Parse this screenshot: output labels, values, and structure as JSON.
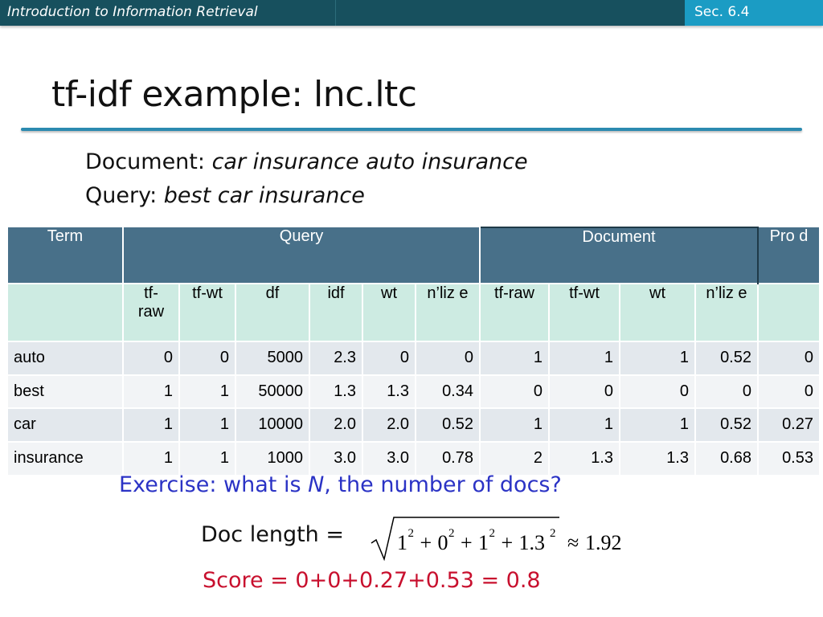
{
  "header": {
    "course_title": "Introduction to Information Retrieval",
    "section": "Sec. 6.4"
  },
  "slide": {
    "title": "tf-idf example: lnc.ltc",
    "document_label": "Document: ",
    "document_text": "car insurance auto insurance",
    "query_label": "Query: ",
    "query_text": "best car insurance"
  },
  "table": {
    "group_headers": {
      "term": "Term",
      "query": "Query",
      "document": "Document",
      "prod": "Pro d"
    },
    "sub_headers": [
      "",
      "tf- raw",
      "tf-wt",
      "df",
      "idf",
      "wt",
      "n’liz e",
      "tf-raw",
      "tf-wt",
      "wt",
      "n’liz e",
      ""
    ],
    "rows": [
      [
        "auto",
        "0",
        "0",
        "5000",
        "2.3",
        "0",
        "0",
        "1",
        "1",
        "1",
        "0.52",
        "0"
      ],
      [
        "best",
        "1",
        "1",
        "50000",
        "1.3",
        "1.3",
        "0.34",
        "0",
        "0",
        "0",
        "0",
        "0"
      ],
      [
        "car",
        "1",
        "1",
        "10000",
        "2.0",
        "2.0",
        "0.52",
        "1",
        "1",
        "1",
        "0.52",
        "0.27"
      ],
      [
        "insurance",
        "1",
        "1",
        "1000",
        "3.0",
        "3.0",
        "0.78",
        "2",
        "1.3",
        "1.3",
        "0.68",
        "0.53"
      ]
    ]
  },
  "exercise": {
    "before": "Exercise: what is ",
    "var": "N",
    "after": ", the number of docs?"
  },
  "doc_length": {
    "label": "Doc length =",
    "formula_terms": [
      "1",
      "0",
      "1",
      "1.3"
    ],
    "exponent": "2",
    "plus": "+",
    "approx": "≈",
    "result": "1.92"
  },
  "score": "Score = 0+0+0.27+0.53 = 0.8",
  "colors": {
    "topbar": "#17505e",
    "section_tab": "#1b9cc4",
    "rule": "#2b8ab0",
    "table_header": "#487089",
    "subheader": "#cdebe2",
    "exercise_text": "#2b33c5",
    "score_text": "#c8102e"
  }
}
